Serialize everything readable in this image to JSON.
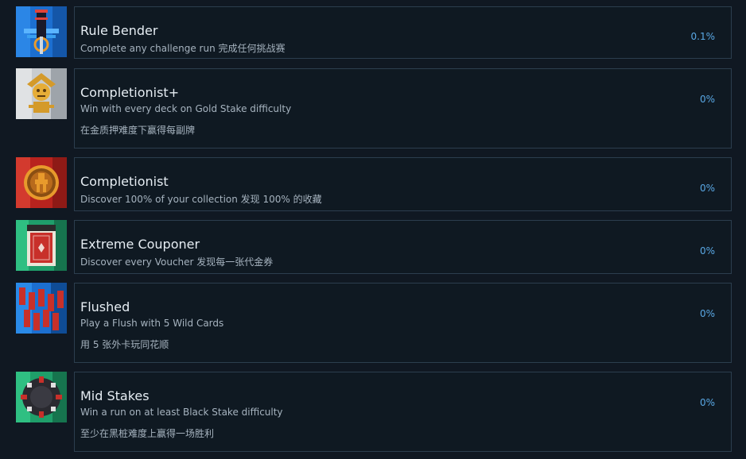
{
  "achievements": [
    {
      "title": "Rule Bender",
      "description": "Complete any challenge run 完成任何挑战赛",
      "description2": "",
      "percent": "0.1%",
      "icon": "sword-tower-icon"
    },
    {
      "title": "Completionist+",
      "description": "Win with every deck on Gold Stake difficulty",
      "description2": "在金质押难度下赢得每副牌",
      "percent": "0%",
      "icon": "gold-jester-icon"
    },
    {
      "title": "Completionist",
      "description": "Discover 100% of your collection 发现 100% 的收藏",
      "description2": "",
      "percent": "0%",
      "icon": "collection-coin-icon"
    },
    {
      "title": "Extreme Couponer",
      "description": "Discover every Voucher 发现每一张代金券",
      "description2": "",
      "percent": "0%",
      "icon": "voucher-card-icon"
    },
    {
      "title": "Flushed",
      "description": "Play a Flush with 5 Wild Cards",
      "description2": "用 5 张外卡玩同花顺",
      "percent": "0%",
      "icon": "wild-cards-icon"
    },
    {
      "title": "Mid Stakes",
      "description": "Win a run on at least Black Stake difficulty",
      "description2": "至少在黑桩难度上赢得一场胜利",
      "percent": "0%",
      "icon": "poker-chip-icon"
    }
  ]
}
